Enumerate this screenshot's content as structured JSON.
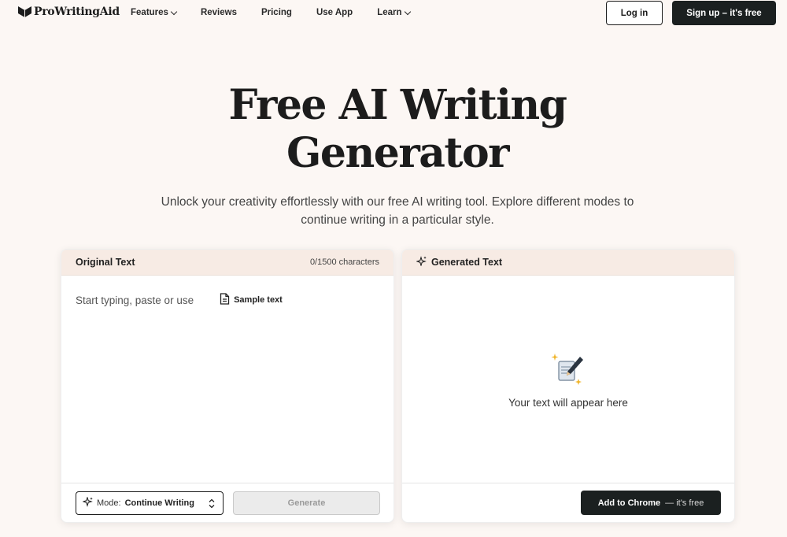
{
  "nav": {
    "logo_text": "ProWritingAid",
    "links": [
      {
        "label": "Features",
        "has_dropdown": true
      },
      {
        "label": "Reviews",
        "has_dropdown": false
      },
      {
        "label": "Pricing",
        "has_dropdown": false
      },
      {
        "label": "Use App",
        "has_dropdown": false
      },
      {
        "label": "Learn",
        "has_dropdown": true
      }
    ],
    "login_label": "Log in",
    "signup_label": "Sign up – it's free"
  },
  "hero": {
    "title_line1": "Free AI Writing",
    "title_line2": "Generator",
    "subtitle_line1": "Unlock your creativity effortlessly with our free AI writing tool. Explore different modes to",
    "subtitle_line2": "continue writing in a particular style."
  },
  "original_panel": {
    "title": "Original Text",
    "char_count": "0/1500 characters",
    "placeholder": "Start typing, paste or use",
    "sample_label": "Sample text",
    "mode_label": "Mode:",
    "mode_value": "Continue Writing",
    "generate_label": "Generate"
  },
  "generated_panel": {
    "title": "Generated Text",
    "empty_text": "Your text will appear here",
    "chrome_label": "Add to Chrome",
    "chrome_sub": "— it's free"
  },
  "colors": {
    "background": "#fcf7f4",
    "dark": "#1b2020",
    "panel_header": "#f7ebe4",
    "sparkle": "#f0b429"
  },
  "icons": [
    "logo-book-icon",
    "chevron-down-icon",
    "document-icon",
    "sparkle-icon",
    "writing-pen-icon",
    "up-down-arrows-icon"
  ]
}
